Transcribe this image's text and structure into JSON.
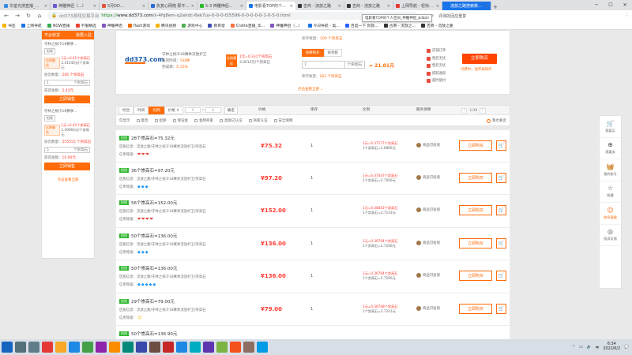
{
  "browser": {
    "tabs": [
      {
        "label": "华莹光搜直播_华莹光搜大...",
        "color": "#3c8dde",
        "active": false
      },
      {
        "label": "神雕神侣（...）",
        "color": "#6a5acd",
        "active": false
      },
      {
        "label": "5月DD...",
        "color": "#e0543e",
        "active": false
      },
      {
        "label": "执复心网络 那不得决XX",
        "color": "#2b6cd6",
        "active": false
      },
      {
        "label": "5-3 神雕神侣...",
        "color": "#2eb82e",
        "active": false
      },
      {
        "label": "电影看TOP的个人空间",
        "color": "#1a73e8",
        "active": true
      },
      {
        "label": "吉商 - 流放之路",
        "color": "#333333",
        "active": false
      },
      {
        "label": "吉商 - 流放之路",
        "color": "#333333",
        "active": false
      },
      {
        "label": "上网导航 - 轻快上网 从...",
        "color": "#e53935",
        "active": false
      },
      {
        "label": "流放之路搜索数据平台",
        "color": "#1a73e8",
        "active": false,
        "blue": true
      }
    ],
    "url_scheme": "https://",
    "url_host": "www.dd373.com",
    "url_path": "/s-4fq8em-q2ahdc-6ek7uv-0-0-0-f25596-0-0-0-0-0-1-0-5-0.html",
    "url_prefix": "dd373游戏交易平台",
    "address_tooltip": "电影看TOP的个人空间_神雕神侣_bilibili",
    "address_right": "评测的回应重复",
    "bookmarks": [
      {
        "label": "书签",
        "color": "#f4b400"
      },
      {
        "label": "上网导航",
        "color": "#1a73e8"
      },
      {
        "label": "NOW直播",
        "color": "#34a853"
      },
      {
        "label": "不服精选",
        "color": "#ea4335"
      },
      {
        "label": "神雕神侣",
        "color": "#7e57c2"
      },
      {
        "label": "flash游戏",
        "color": "#ef6c00"
      },
      {
        "label": "腾讯视频",
        "color": "#f4b400"
      },
      {
        "label": "游戏中心",
        "color": "#4caf50"
      },
      {
        "label": "教育窗",
        "color": "#3f51b5"
      },
      {
        "label": "Cratte直播_华...",
        "color": "#ff7043"
      },
      {
        "label": "神雕神侣（...）",
        "color": "#7e57c2"
      },
      {
        "label": "今日导航 - 奥...",
        "color": "#1a73e8"
      },
      {
        "label": "百度一下 你就...",
        "color": "#2962ff"
      },
      {
        "label": "古商 - 流放之...",
        "color": "#333333"
      },
      {
        "label": "吉商 - 流放之路",
        "color": "#333333"
      }
    ]
  },
  "sidebar": {
    "title": "平台收货",
    "secondary": "我要入驻",
    "subtitle": "",
    "cards": [
      {
        "name": "守林之祝冷18赛季...",
        "badge": "担保",
        "rate_tag": "比例最佳",
        "rate1": "1元=0.41个崇高石",
        "rate2": "2.41546元/个崇高石",
        "qty_label": "收货数量：",
        "qty_value": "266 个崇高石",
        "input_value": "1",
        "unit": "个崇高石",
        "amount_label": "获得金额：",
        "amount_value": "2.42元",
        "button": "立即销售"
      },
      {
        "name": "守林之祝冷18赛季...",
        "badge": "担保",
        "rate_tag": "比例最佳",
        "rate1": "1元=0.42个崇高石",
        "rate2": "2.40964元/个崇高石",
        "qty_label": "收货数量：",
        "qty_value": "555555 个崇高石",
        "input_value": "5",
        "unit": "个崇高石",
        "amount_label": "获得金额：",
        "amount_value": "10.00元",
        "button": "立即销售"
      }
    ],
    "more": "点击查看全部"
  },
  "top": {
    "logo": "dd373.com",
    "server": "守林之祝冷18赛季流放护卫",
    "delivery_label": "发货时间",
    "delivery_value": "5分钟",
    "complete_label": "完成率",
    "complete_value": "0.15%",
    "rate_tag": "比例最佳",
    "rate1": "1元=0.331个崇高石",
    "rate2": "3.0012元/个崇高石",
    "qty_label": "库存数量：",
    "qty_value": "109 个崇高石",
    "tab_buy": "按数购买",
    "tab_amount": "按金额",
    "input_value": "7",
    "unit": "个崇高石",
    "equals": "= 21.01元",
    "stock_label": "库存数量：",
    "stock_value": "263 个崇高石",
    "badges": [
      "店铺订单",
      "售后无忧",
      "售后无忧",
      "提取通道",
      "超时赔付"
    ],
    "buy_button": "立即购买",
    "safe": "付费中，放弃再保护",
    "more": "点击查看全部"
  },
  "filter": {
    "segments": [
      "综合",
      "时间",
      "比例",
      "价格 ⇕"
    ],
    "range_from": "¥",
    "range_to": "¥",
    "confirm": "确定",
    "columns": [
      "价格",
      "库存",
      "比例",
      "服务保障"
    ],
    "page": "1/39",
    "prev": "‹",
    "next": "›",
    "checks": [
      "仅显示",
      "着急",
      "担保",
      "保证金",
      "金牌商家",
      "直接已认证",
      "商家认证",
      "安全保障"
    ],
    "sale": "我也要卖"
  },
  "rows": [
    {
      "tag": "担保",
      "title": "28个崇高石=75.32元",
      "server": "区服信息：流放之路/守林之祝冷18赛季流放护卫/崇高石",
      "rating": "信用等级：",
      "rating_icon": "heart",
      "rating_count": 3,
      "price": "¥75.32",
      "stock": "1",
      "ratio1": "1元=0.37177个崇高石",
      "ratio2": "1个崇高石=2.6866元",
      "service": "商品可投保",
      "buy": "立即购买"
    },
    {
      "tag": "担保",
      "title": "36个崇高石=97.20元",
      "server": "区服信息：流放之路/守林之祝冷18赛季流放护卫/崇高石",
      "rating": "信用等级：",
      "rating_icon": "diamond",
      "rating_count": 3,
      "price": "¥97.20",
      "stock": "1",
      "ratio1": "1元=0.37047个崇高石",
      "ratio2": "1个崇高石=2.7000元",
      "service": "商品可投保",
      "buy": "立即购买"
    },
    {
      "tag": "担保",
      "title": "56个崇高石=152.00元",
      "server": "区服信息：流放之路/守林之祝冷18赛季流放护卫/崇高石",
      "rating": "信用等级：",
      "rating_icon": "heart",
      "rating_count": 4,
      "price": "¥152.00",
      "stock": "1",
      "ratio1": "1元=0.36842个崇高石",
      "ratio2": "1个崇高石=2.7143元",
      "service": "商品可投保",
      "buy": "立即购买"
    },
    {
      "tag": "担保",
      "title": "50个崇高石=136.00元",
      "server": "区服信息：流放之路/守林之祝冷18赛季流放护卫/崇高石",
      "rating": "信用等级：",
      "rating_icon": "diamond",
      "rating_count": 3,
      "price": "¥136.00",
      "stock": "1",
      "ratio1": "1元=0.36764个崇高石",
      "ratio2": "1个崇高石=2.7200元",
      "service": "商品可投保",
      "buy": "立即购买"
    },
    {
      "tag": "担保",
      "title": "50个崇高石=136.00元",
      "server": "区服信息：流放之路/守林之祝冷18赛季流放护卫/崇高石",
      "rating": "信用等级：",
      "rating_icon": "diamond",
      "rating_count": 5,
      "price": "¥136.00",
      "stock": "1",
      "ratio1": "1元=0.36764个崇高石",
      "ratio2": "1个崇高石=2.7200元",
      "service": "商品可投保",
      "buy": "立即购买"
    },
    {
      "tag": "担保",
      "title": "29个崇高石=79.00元",
      "server": "区服信息：流放之路/守林之祝冷18赛季流放护卫/崇高石",
      "rating": "信用等级：",
      "rating_icon": "smile",
      "rating_count": 1,
      "price": "¥79.00",
      "stock": "1",
      "ratio1": "1元=0.36708个崇高石",
      "ratio2": "1个崇高石=2.7241元",
      "service": "商品可投保",
      "buy": "立即购买"
    },
    {
      "tag": "担保",
      "title": "50个崇高石=136.90元",
      "server": "",
      "rating": "",
      "rating_icon": "",
      "rating_count": 0,
      "price": "",
      "stock": "",
      "ratio1": "",
      "ratio2": "",
      "service": "",
      "buy": ""
    }
  ],
  "rightbar": [
    {
      "icon": "cart-icon",
      "glyph": "🛒",
      "label": "我要买"
    },
    {
      "icon": "sell-icon",
      "glyph": "⊕",
      "label": "我要卖"
    },
    {
      "icon": "basket-icon",
      "glyph": "🧺",
      "label": "我的账号"
    },
    {
      "icon": "star-icon",
      "glyph": "☆",
      "label": "收藏"
    },
    {
      "icon": "service-icon",
      "glyph": "☺",
      "label": "联系客服",
      "highlight": true
    },
    {
      "icon": "feedback-icon",
      "glyph": "◎",
      "label": "投诉反馈"
    }
  ],
  "taskbar": {
    "apps": [
      {
        "name": "start",
        "color": "#1565c0"
      },
      {
        "name": "search",
        "color": "#546e7a"
      },
      {
        "name": "taskview",
        "color": "#607d8b"
      },
      {
        "name": "chrome",
        "color": "#e53935"
      },
      {
        "name": "explorer",
        "color": "#f9a825"
      },
      {
        "name": "word",
        "color": "#1e88e5"
      },
      {
        "name": "app1",
        "color": "#43a047"
      },
      {
        "name": "app2",
        "color": "#8e24aa"
      },
      {
        "name": "app3",
        "color": "#fb8c00"
      },
      {
        "name": "app4",
        "color": "#00897b"
      },
      {
        "name": "app5",
        "color": "#3949ab"
      },
      {
        "name": "app6",
        "color": "#6d4c41"
      },
      {
        "name": "app7",
        "color": "#c62828"
      },
      {
        "name": "app8",
        "color": "#1e88e5"
      },
      {
        "name": "app9",
        "color": "#00acc1"
      },
      {
        "name": "app10",
        "color": "#5e35b1"
      },
      {
        "name": "app11",
        "color": "#7cb342"
      },
      {
        "name": "app12",
        "color": "#f4511e"
      },
      {
        "name": "app13",
        "color": "#8d6e63"
      },
      {
        "name": "app14",
        "color": "#039be5"
      }
    ],
    "time": "6:34",
    "date": "2022/6/2",
    "ime": "中"
  }
}
